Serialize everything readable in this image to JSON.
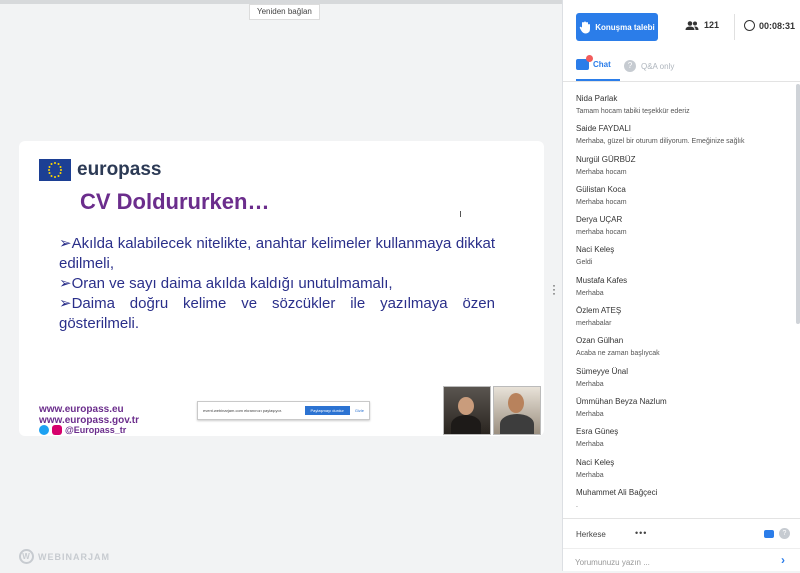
{
  "reconnect_label": "Yeniden bağlan",
  "slide": {
    "brand": "europass",
    "title": "CV Doldururken…",
    "bullets": [
      "Akılda kalabilecek nitelikte, anahtar kelimeler kullanmaya dikkat edilmeli,",
      "Oran ve sayı daima akılda kaldığı unutulmamalı,",
      "Daima doğru kelime ve sözcükler ile yazılmaya özen gösterilmeli."
    ],
    "bullet_marker": "➢",
    "link1": "www.europass.eu",
    "link2": "www.europass.gov.tr",
    "social": "@Europass_tr"
  },
  "share_bar": {
    "text": "event.webinarjam.com ekranınızı paylaşıyor.",
    "stop_label": "Paylaşmayı durdur",
    "hide_label": "Gizle"
  },
  "logo": {
    "mark": "W",
    "text": "WEBINARJAM"
  },
  "panel": {
    "speak_button": "Konuşma talebi",
    "participants": "121",
    "timer": "00:08:31",
    "tab_chat": "Chat",
    "tab_qa": "Q&A only",
    "qa_icon": "?",
    "help_icon": "?",
    "messages": [
      {
        "name": "Nida Parlak",
        "text": "Tamam hocam tabiki teşekkür ederiz"
      },
      {
        "name": "Saide FAYDALI",
        "text": "Merhaba, güzel bir oturum diliyorum. Emeğinize sağlık"
      },
      {
        "name": "Nurgül GÜRBÜZ",
        "text": "Merhaba hocam"
      },
      {
        "name": "Gülistan Koca",
        "text": "Merhaba hocam"
      },
      {
        "name": "Derya UÇAR",
        "text": "merhaba hocam"
      },
      {
        "name": "Naci Keleş",
        "text": "Geldi"
      },
      {
        "name": "Mustafa Kafes",
        "text": "Merhaba"
      },
      {
        "name": "Özlem ATEŞ",
        "text": "merhabalar"
      },
      {
        "name": "Ozan Gülhan",
        "text": "Acaba ne zaman başlıycak"
      },
      {
        "name": "Sümeyye Ünal",
        "text": "Merhaba"
      },
      {
        "name": "Ümmühan Beyza Nazlum",
        "text": "Merhaba"
      },
      {
        "name": "Esra Güneş",
        "text": "Merhaba"
      },
      {
        "name": "Naci Keleş",
        "text": "Merhaba"
      },
      {
        "name": "Muhammet Ali Bağçeci",
        "text": "."
      }
    ],
    "recipient": "Herkese",
    "more": "•••",
    "comment_placeholder": "Yorumunuzu yazın ...",
    "send_icon": "›"
  },
  "colors": {
    "accent": "#2b7de9",
    "slide_title": "#6b2d8c",
    "bullet_text": "#2a2f8a"
  }
}
